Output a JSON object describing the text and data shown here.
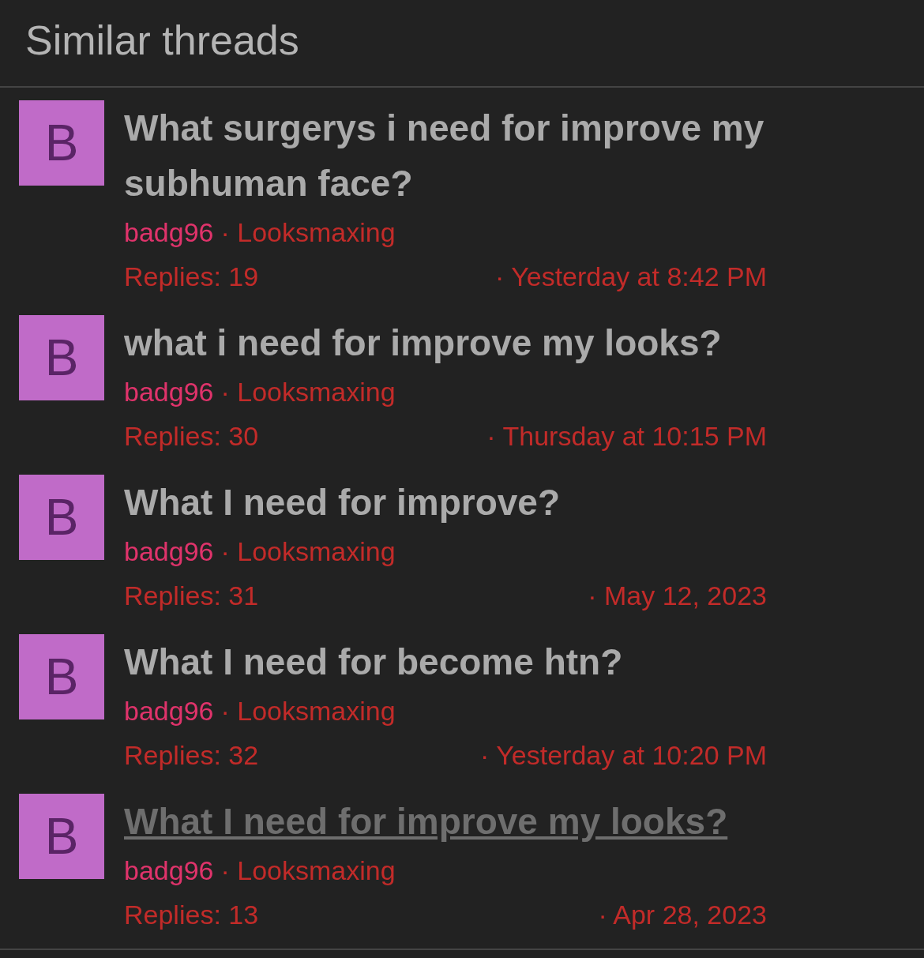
{
  "title": "Similar threads",
  "threads": [
    {
      "avatar": "B",
      "title": "What surgerys i need for improve my subhuman face?",
      "visited": false,
      "author": "badg96",
      "forum": "· Looksmaxing",
      "replies": "Replies: 19",
      "date": "· Yesterday at 8:42 PM"
    },
    {
      "avatar": "B",
      "title": "what i need for improve my looks?",
      "visited": false,
      "author": "badg96",
      "forum": "· Looksmaxing",
      "replies": "Replies: 30",
      "date": "· Thursday at 10:15 PM"
    },
    {
      "avatar": "B",
      "title": "What I need for improve?",
      "visited": false,
      "author": "badg96",
      "forum": "· Looksmaxing",
      "replies": "Replies: 31",
      "date": "· May 12, 2023"
    },
    {
      "avatar": "B",
      "title": "What I need for become htn?",
      "visited": false,
      "author": "badg96",
      "forum": "· Looksmaxing",
      "replies": "Replies: 32",
      "date": "· Yesterday at 10:20 PM"
    },
    {
      "avatar": "B",
      "title": "What I need for improve my looks?",
      "visited": true,
      "author": "badg96",
      "forum": "· Looksmaxing",
      "replies": "Replies: 13",
      "date": "· Apr 28, 2023"
    }
  ]
}
